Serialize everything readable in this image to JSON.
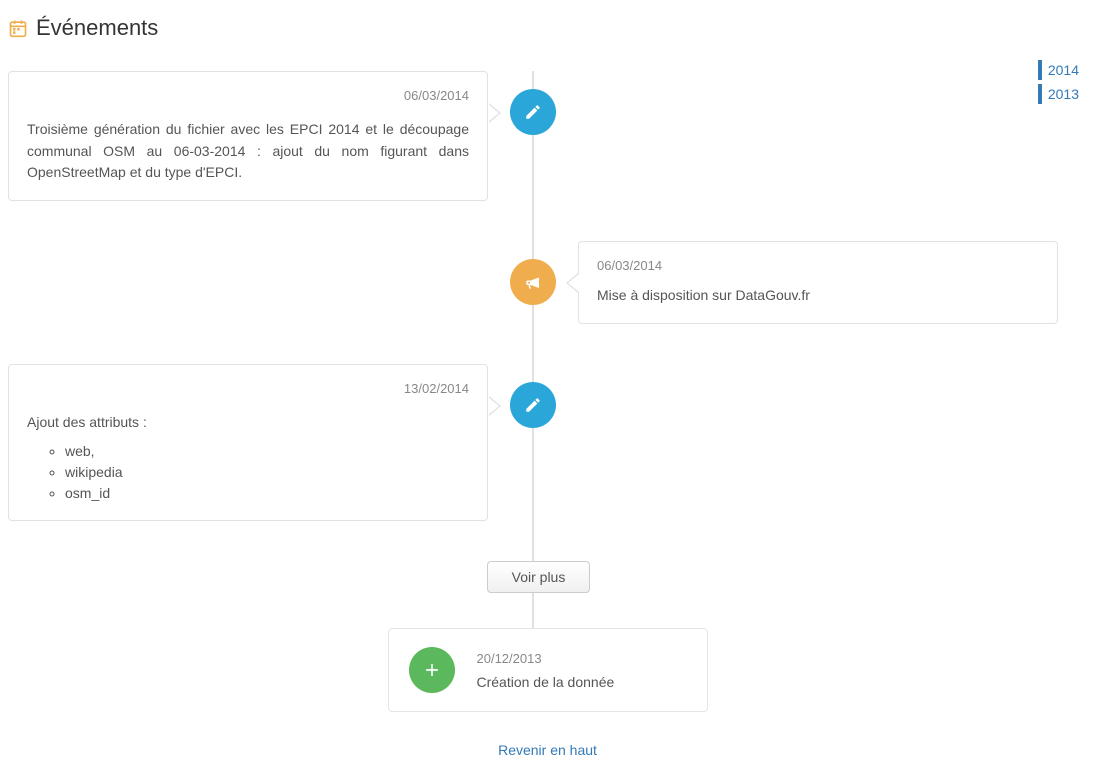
{
  "header": {
    "title": "Événements"
  },
  "yearNav": [
    "2014",
    "2013"
  ],
  "events": [
    {
      "date": "06/03/2014",
      "content": "Troisième génération du fichier avec les EPCI 2014 et le découpage communal OSM au 06-03-2014 : ajout du nom figurant dans OpenStreetMap et du type d'EPCI."
    },
    {
      "date": "06/03/2014",
      "content": "Mise à disposition sur DataGouv.fr"
    },
    {
      "date": "13/02/2014",
      "intro": "Ajout des attributs :",
      "items": [
        "web,",
        "wikipedia",
        "osm_id"
      ]
    }
  ],
  "voirPlus": "Voir plus",
  "creation": {
    "date": "20/12/2013",
    "text": "Création de la donnée"
  },
  "revenir": "Revenir en haut"
}
